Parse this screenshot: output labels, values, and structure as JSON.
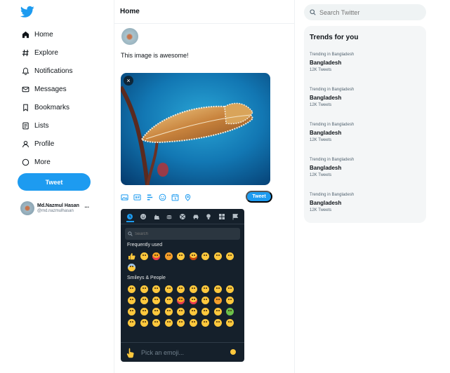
{
  "colors": {
    "accent": "#1d9bf0",
    "picker_bg": "#15202b",
    "trends_bg": "#f4f6f7"
  },
  "nav": {
    "logo_icon": "twitter-bird-icon",
    "items": [
      {
        "label": "Home",
        "icon": "home-icon"
      },
      {
        "label": "Explore",
        "icon": "hashtag-icon"
      },
      {
        "label": "Notifications",
        "icon": "bell-icon"
      },
      {
        "label": "Messages",
        "icon": "envelope-icon"
      },
      {
        "label": "Bookmarks",
        "icon": "bookmark-icon"
      },
      {
        "label": "Lists",
        "icon": "list-icon"
      },
      {
        "label": "Profile",
        "icon": "person-icon"
      },
      {
        "label": "More",
        "icon": "more-circle-icon"
      }
    ],
    "tweet_button": "Tweet",
    "profile": {
      "name": "Md.Nazmul Hasan",
      "handle": "@md.nazmulhasan",
      "more": "..."
    }
  },
  "main": {
    "header": "Home",
    "compose_text": "This image is awesome!",
    "close_label": "×",
    "tweet_button": "Tweet",
    "toolbar_icons": [
      "image-icon",
      "gif-icon",
      "poll-icon",
      "emoji-icon",
      "schedule-icon",
      "location-icon"
    ]
  },
  "emoji_picker": {
    "search_placeholder": "Search",
    "section_frequent": "Frequently used",
    "section_smileys": "Smileys & People",
    "footer_label": "Pick an emoji...",
    "categories": [
      "recent-icon",
      "smiley-icon",
      "animal-icon",
      "food-icon",
      "activity-icon",
      "travel-icon",
      "object-icon",
      "symbol-icon",
      "flag-icon"
    ]
  },
  "search": {
    "placeholder": "Search Twitter"
  },
  "trends": {
    "title": "Trends for you",
    "items": [
      {
        "context": "Trending in Bangladesh",
        "name": "Bangladesh",
        "count": "12K Tweets"
      },
      {
        "context": "Trending in Bangladesh",
        "name": "Bangladesh",
        "count": "12K Tweets"
      },
      {
        "context": "Trending in Bangladesh",
        "name": "Bangladesh",
        "count": "12K Tweets"
      },
      {
        "context": "Trending in Bangladesh",
        "name": "Bangladesh",
        "count": "12K Tweets"
      },
      {
        "context": "Trending in Bangladesh",
        "name": "Bangladesh",
        "count": "12K Tweets"
      }
    ]
  }
}
